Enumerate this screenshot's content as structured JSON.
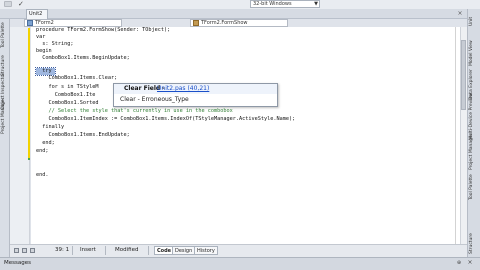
{
  "top_bar": {
    "platform_combo": "32-bit Windows"
  },
  "editor_tabs": {
    "active_tab": "Unit2"
  },
  "left_panel": {
    "items": [
      "Tool Palette",
      "Structure",
      "Object Inspector",
      "Project Manager"
    ]
  },
  "proc_combo": {
    "left": "TForm2",
    "right": "TForm2.FormShow"
  },
  "code_lines": [
    "procedure TForm2.FormShow(Sender: TObject);",
    "var",
    "  s: String;",
    "begin",
    "  ComboBox1.Items.BeginUpdate;",
    "  try",
    "    ComboBox1.Items.Clear;",
    "    for s in TStyleM",
    "      ComboBox1.Ite",
    "    ComboBox1.Sorted",
    "    // Select the style that's currently in use in the combobox",
    "    ComboBox1.ItemIndex := ComboBox1.Items.IndexOf(TStyleManager.ActiveStyle.Name);",
    "  finally",
    "    ComboBox1.Items.EndUpdate;",
    "  end;",
    "end;",
    "",
    "",
    "end."
  ],
  "error_popup": {
    "title": "Clear Field -",
    "link": "Unit2.pas (40,21)",
    "row2": "Clear - Erroneous_Type"
  },
  "right_panel": {
    "items": [
      "Unit",
      "Model View",
      "Data Explorer",
      "Multi-Device Preview",
      "Project Manager",
      "Tool Palette",
      "Structure"
    ]
  },
  "status_bar": {
    "position": "39: 1",
    "mode": "Insert",
    "modified": "Modified",
    "tabs": [
      "Code",
      "Design",
      "History"
    ]
  },
  "messages": {
    "label": "Messages"
  }
}
